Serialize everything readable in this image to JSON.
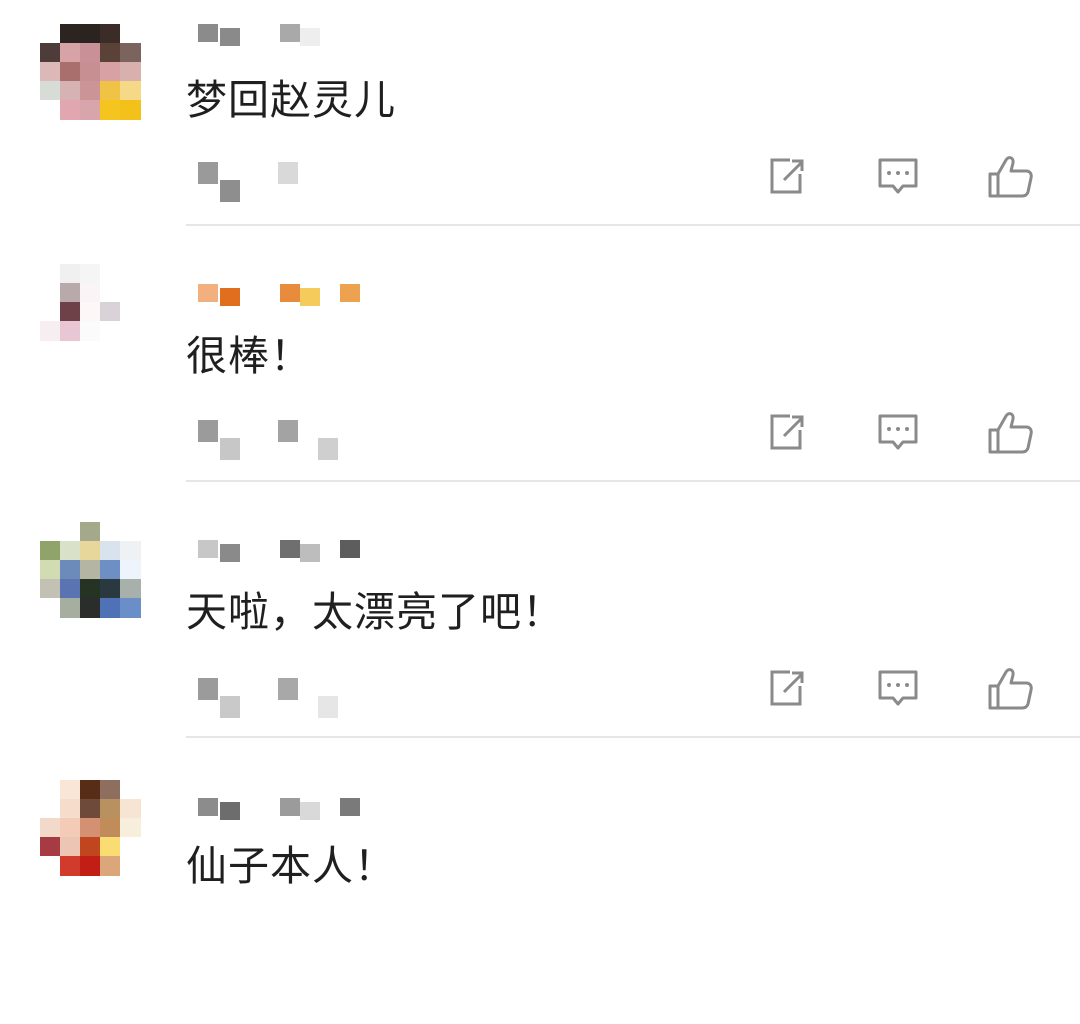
{
  "comments": [
    {
      "text": "梦回赵灵儿",
      "avatar_colors": [
        [
          "#ffffff",
          "#2b2421",
          "#2a2320",
          "#3b2c28",
          "#ffffff"
        ],
        [
          "#4d3c3a",
          "#d8a3a6",
          "#c99097",
          "#5a4238",
          "#7a645d"
        ],
        [
          "#dcb8b8",
          "#a96f6c",
          "#c78f91",
          "#d8a2a5",
          "#d8b1ae"
        ],
        [
          "#d7dcd6",
          "#d6b2b3",
          "#cb9597",
          "#f0c246",
          "#f5d987"
        ],
        [
          "#ffffff",
          "#e1a7b1",
          "#d9a5ad",
          "#f5c51f",
          "#f4c11a"
        ]
      ],
      "name_colors": [
        "#8b8b8b",
        "#8a8a8a",
        "#a9a9a9",
        "#eeeeee"
      ],
      "meta_colors": [
        "#9a9a9a",
        "#8e8e8e",
        "#d9d9d9"
      ]
    },
    {
      "text": "很棒！",
      "avatar_colors": [
        [
          "#ffffff",
          "#f0f0f0",
          "#f5f5f5",
          "#ffffff",
          "#ffffff"
        ],
        [
          "#ffffff",
          "#b8aaaa",
          "#fbf4f6",
          "#ffffff",
          "#ffffff"
        ],
        [
          "#ffffff",
          "#6e4149",
          "#fdf7f8",
          "#d9d2d6",
          "#ffffff"
        ],
        [
          "#f6eef1",
          "#e8c6d3",
          "#fbfbfb",
          "#ffffff",
          "#ffffff"
        ]
      ],
      "name_colors": [
        "#f2b07f",
        "#e06e1e",
        "#e88b3d",
        "#f5cc5c",
        "#eca24e"
      ],
      "meta_colors": [
        "#9b9b9b",
        "#c7c7c7",
        "#a3a3a3",
        "#cfcfcf"
      ]
    },
    {
      "text": "天啦，太漂亮了吧！",
      "avatar_colors": [
        [
          "#ffffff",
          "#ffffff",
          "#a3a98a",
          "#ffffff",
          "#ffffff"
        ],
        [
          "#8fa36b",
          "#d9e1c8",
          "#e8d79b",
          "#d8e3ee",
          "#eef2f4"
        ],
        [
          "#d1dcb2",
          "#6c8bbb",
          "#b5b5a4",
          "#6e8fc4",
          "#eef4fb"
        ],
        [
          "#c2c1b3",
          "#5974b0",
          "#243323",
          "#2a3940",
          "#a7b0aa"
        ],
        [
          "#ffffff",
          "#a6aea0",
          "#2a2d2a",
          "#4f71b5",
          "#6a8ec7"
        ]
      ],
      "name_colors": [
        "#c7c7c7",
        "#8a8a8a",
        "#6f6f6f",
        "#bdbdbd",
        "#5d5d5d"
      ],
      "meta_colors": [
        "#9b9b9b",
        "#c9c9c9",
        "#a8a8a8",
        "#e6e6e6"
      ]
    },
    {
      "text": "仙子本人！",
      "avatar_colors": [
        [
          "#ffffff",
          "#f8e7d6",
          "#572d18",
          "#8d6e5f",
          "#ffffff"
        ],
        [
          "#ffffff",
          "#f6dccb",
          "#6e4a3a",
          "#b9905f",
          "#f6e5d2"
        ],
        [
          "#f2d9c9",
          "#f3cbb6",
          "#d39072",
          "#c08d5a",
          "#f8eedc"
        ],
        [
          "#a73b43",
          "#ecc5b5",
          "#c0461f",
          "#f9dd73",
          "#ffffff"
        ],
        [
          "#ffffff",
          "#d13b2b",
          "#c21e15",
          "#dba679",
          "#ffffff"
        ]
      ],
      "name_colors": [
        "#8c8c8c",
        "#6d6d6d",
        "#9b9b9b",
        "#d9d9d9",
        "#7a7a7a"
      ],
      "meta_colors": []
    }
  ],
  "action_icons": {
    "share": "share-icon",
    "reply": "comment-icon",
    "like": "thumbs-up-icon"
  },
  "icon_color": "#8a8a8a"
}
